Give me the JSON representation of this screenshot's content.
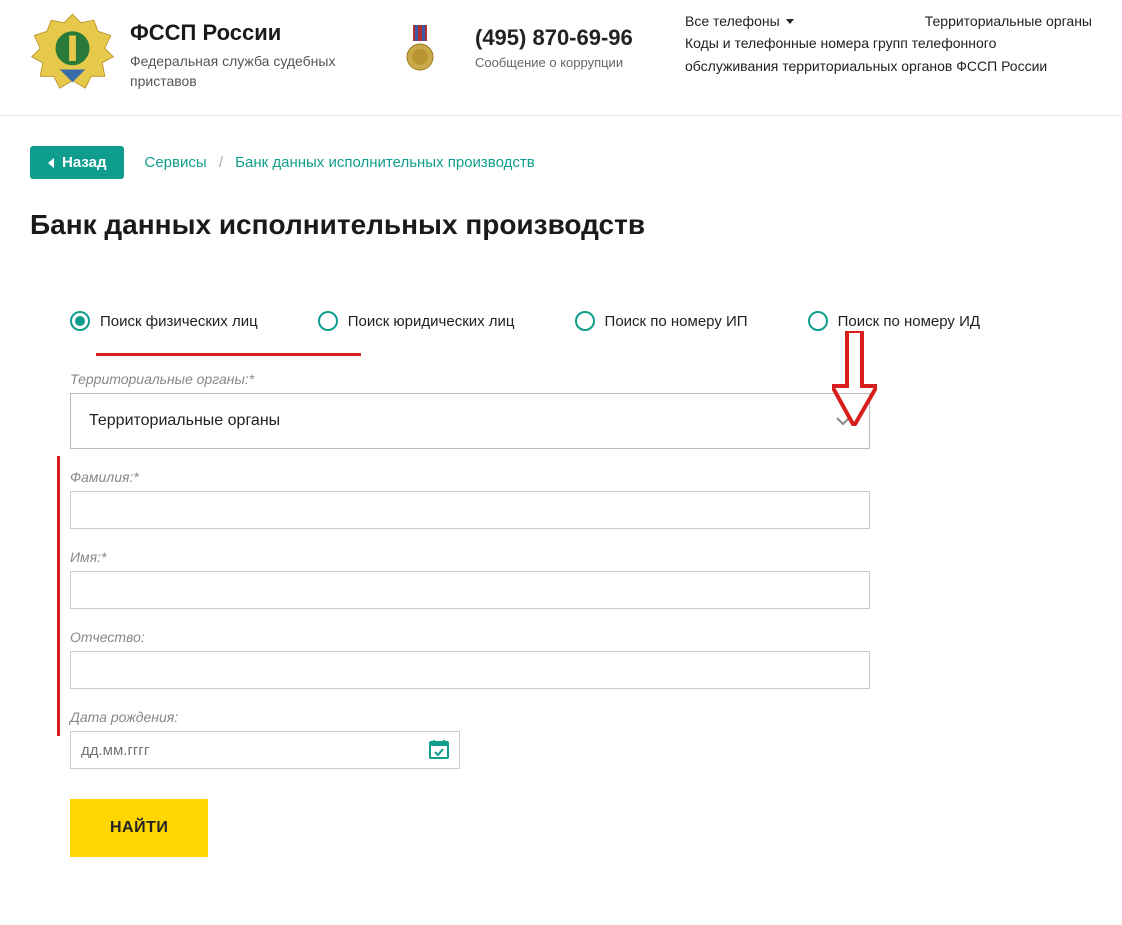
{
  "header": {
    "org_title": "ФССП России",
    "org_sub": "Федеральная служба судебных приставов",
    "phone": "(495) 870-69-96",
    "phone_sub": "Сообщение о коррупции",
    "link_phones": "Все телефоны",
    "link_territorial": "Территориальные органы",
    "link_codes": "Коды и телефонные номера групп телефонного обслуживания территориальных органов ФССП России"
  },
  "nav": {
    "back": "Назад",
    "crumb_services": "Сервисы",
    "crumb_current": "Банк данных исполнительных производств"
  },
  "page_title": "Банк данных исполнительных производств",
  "tabs": {
    "t1": "Поиск физических лиц",
    "t2": "Поиск юридических лиц",
    "t3": "Поиск по номеру ИП",
    "t4": "Поиск по номеру ИД"
  },
  "form": {
    "label_territory": "Территориальные органы:*",
    "select_territory": "Территориальные органы",
    "label_lastname": "Фамилия:*",
    "label_firstname": "Имя:*",
    "label_patronymic": "Отчество:",
    "label_dob": "Дата рождения:",
    "placeholder_dob": "дд.мм.гггг",
    "submit": "НАЙТИ"
  }
}
